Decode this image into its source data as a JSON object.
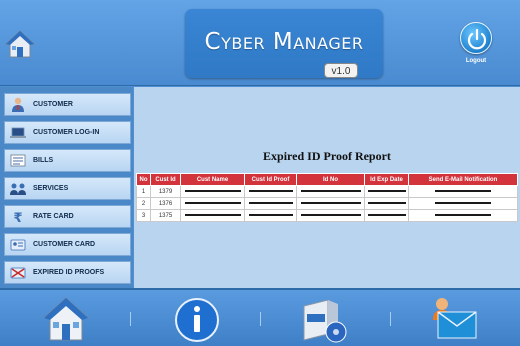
{
  "header": {
    "title": "Cyber Manager",
    "version": "v1.0",
    "logout_label": "Logout"
  },
  "sidebar": {
    "items": [
      {
        "label": "CUSTOMER",
        "icon": "customer-icon"
      },
      {
        "label": "CUSTOMER LOG-IN",
        "icon": "laptop-icon"
      },
      {
        "label": "BILLS",
        "icon": "bills-icon"
      },
      {
        "label": "SERVICES",
        "icon": "services-icon"
      },
      {
        "label": "RATE CARD",
        "icon": "rupee-icon"
      },
      {
        "label": "CUSTOMER CARD",
        "icon": "id-card-icon"
      },
      {
        "label": "EXPIRED ID PROOFS",
        "icon": "expired-id-icon"
      }
    ]
  },
  "report": {
    "title": "Expired ID Proof Report",
    "columns": [
      "No",
      "Cust Id",
      "Cust Name",
      "Cust Id Proof",
      "Id No",
      "Id Exp Date",
      "Send E-Mail Notification"
    ],
    "rows": [
      {
        "no": "1",
        "cust_id": "1379"
      },
      {
        "no": "2",
        "cust_id": "1376"
      },
      {
        "no": "3",
        "cust_id": "1375"
      }
    ]
  },
  "footer": {
    "icons": [
      "home-icon",
      "info-icon",
      "software-box-icon",
      "email-icon"
    ]
  },
  "colors": {
    "background": "#4f8fd2",
    "title_box": "#2f79c6",
    "table_header": "#d3343c",
    "content_area": "#b9d4ef"
  }
}
